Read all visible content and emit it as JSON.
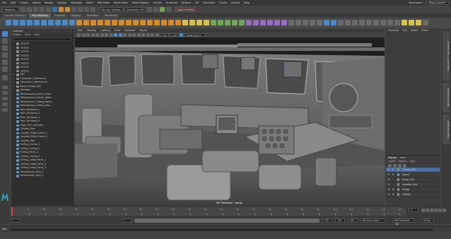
{
  "menubar": {
    "items": [
      "File",
      "Edit",
      "Create",
      "Select",
      "Modify",
      "Display",
      "Windows",
      "Mesh",
      "Edit Mesh",
      "Mesh Tools",
      "Mesh Display",
      "Curves",
      "Surfaces",
      "Deform",
      "UV",
      "Generate",
      "Cache",
      "Arnold",
      "Help"
    ],
    "workspace_label": "Workspace :",
    "workspace_value": "Maya Classic*"
  },
  "statusline": {
    "menuset": "Modeling",
    "live_surface": "No Live Surface",
    "symmetry": "Symmetry: Off",
    "user": "Jason Barfield"
  },
  "shelf_tabs": {
    "tabs": [
      "Curves / Surfaces",
      "Poly Modeling",
      "Sculpting",
      "Rigging",
      "Animation",
      "Rendering"
    ],
    "active": "Poly Modeling"
  },
  "outliner": {
    "title": "Outliner",
    "menu": [
      "Display",
      "Show",
      "Help"
    ],
    "rows": [
      {
        "label": "",
        "dim": true
      },
      {
        "label": "",
        "dim": true
      },
      {
        "label": "",
        "dim": true
      },
      {
        "label": "",
        "dim": true
      },
      {
        "label": "",
        "dim": true
      },
      {
        "label": "",
        "dim": true
      },
      {
        "label": "",
        "dim": true
      },
      {
        "label": "",
        "dim": true
      },
      {
        "label": "Rail"
      },
      {
        "label": "Character1_Reference"
      },
      {
        "label": "Character1_Reference1"
      },
      {
        "label": "Body_Interior_Rail"
      },
      {
        "label": "Windows"
      },
      {
        "label": "Wheelhouse_Interior_Floor"
      },
      {
        "label": "Wheelhouse_Interior_Walls"
      },
      {
        "label": "Wheelhouse_Ceiling_Panels"
      },
      {
        "label": "Wheelhouse_Ceiling_Tiles"
      },
      {
        "label": "Rear_Windows_1"
      },
      {
        "label": "Rear_Windows_2"
      },
      {
        "label": "Rear_Windows_3"
      },
      {
        "label": "Rear_Windows_4"
      },
      {
        "label": "Edge_Trim_Verticals"
      },
      {
        "label": "Counter_Box"
      },
      {
        "label": "Counter_Edge_Guard_1"
      },
      {
        "label": "Counter_Edge_Guard_2"
      },
      {
        "label": "Counter_Top"
      },
      {
        "label": "Ceiling_Coving_1"
      },
      {
        "label": "Ceiling_Coving_2"
      },
      {
        "label": "Ceiling_Panel_1"
      },
      {
        "label": "Ceiling_Coving_3"
      },
      {
        "label": "Ceiling_Cable_Panel_1"
      },
      {
        "label": "Ceiling_Cable_Panel_2"
      },
      {
        "label": "Ceiling_Cable_Panel_3"
      },
      {
        "label": "Wheelhouse_Vent_1"
      },
      {
        "label": "Wheelhouse_Vent_2"
      }
    ]
  },
  "viewport": {
    "menu": [
      "View",
      "Shading",
      "Lighting",
      "Show",
      "Renderer",
      "Panels"
    ],
    "field_a": "0.00",
    "field_b": "1.00",
    "colorspace": "sRGB gamma",
    "camera_label": "Wt Fleetbean : persp"
  },
  "channelbox": {
    "menu": [
      "Channels",
      "Edit",
      "Object",
      "Show"
    ]
  },
  "sidetabs": [
    "Channel Box / Layer Editor",
    "Modeling Toolkit",
    "Attribute Editor"
  ],
  "layers": {
    "tabs": [
      "Display",
      "Anim"
    ],
    "menu": [
      "Layers",
      "Options",
      "Help"
    ],
    "rows": [
      {
        "v": "V",
        "p": "P",
        "name": "Interior_Sill",
        "active": true,
        "color": "#888888"
      },
      {
        "v": "V",
        "p": "P",
        "name": "layer1",
        "active": false,
        "color": "#6a8ac8"
      },
      {
        "v": "V",
        "p": "",
        "name": "Body_Hull",
        "active": false,
        "color": "#888888"
      },
      {
        "v": "V",
        "p": "",
        "name": "Isolated_Hull",
        "active": false,
        "color": "#888888"
      },
      {
        "v": "V",
        "p": "R",
        "name": "Shops",
        "active": false,
        "color": "#888888"
      },
      {
        "v": "V",
        "p": "R",
        "name": "Figures",
        "active": false,
        "color": "#888888"
      }
    ]
  },
  "timeslider": {
    "ticks": [
      "5",
      "10",
      "15",
      "20",
      "25",
      "30",
      "35",
      "40",
      "45",
      "50",
      "55",
      "60",
      "65",
      "70",
      "75",
      "80",
      "85",
      "90",
      "95",
      "100",
      "105",
      "110",
      "115",
      "120"
    ],
    "current_frame": "1"
  },
  "rangeslider": {
    "start": "1",
    "start_inner": "1",
    "end_inner": "120",
    "end": "120",
    "end2": "200",
    "anim_layer": "No Anim Layer",
    "char_set": "No Character Set",
    "fps": "24 fps"
  },
  "cmdline": {
    "label": "MEL"
  }
}
